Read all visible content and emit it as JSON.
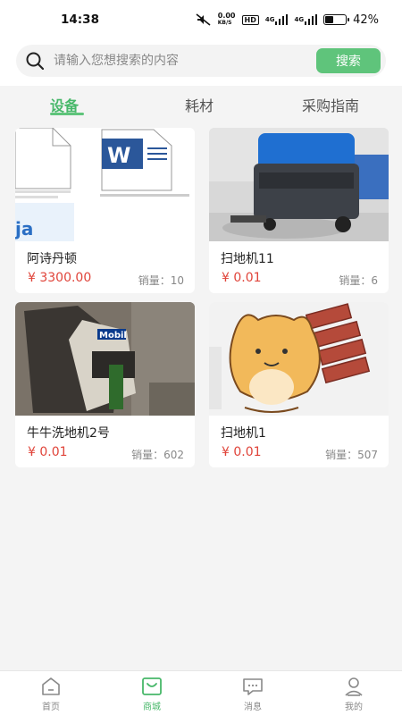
{
  "status": {
    "time": "14:38",
    "net_speed": "0.00",
    "net_unit": "KB/S",
    "hd": "HD",
    "signal1": "4G",
    "signal2": "4G",
    "battery_pct": "42%",
    "battery_level": 0.42
  },
  "search": {
    "placeholder": "请输入您想搜索的内容",
    "button_label": "搜索"
  },
  "tabs": [
    {
      "label": "设备",
      "active": true
    },
    {
      "label": "耗材",
      "active": false
    },
    {
      "label": "采购指南",
      "active": false
    }
  ],
  "products": [
    {
      "title": "阿诗丹顿",
      "price": "¥ 3300.00",
      "sales": "销量：10"
    },
    {
      "title": "扫地机11",
      "price": "¥ 0.01",
      "sales": "销量：6"
    },
    {
      "title": "牛牛洗地机2号",
      "price": "¥ 0.01",
      "sales": "销量：602"
    },
    {
      "title": "扫地机1",
      "price": "¥ 0.01",
      "sales": "销量：507"
    }
  ],
  "nav": [
    {
      "label": "首页",
      "icon": "home-icon",
      "active": false
    },
    {
      "label": "商城",
      "icon": "mall-icon",
      "active": true
    },
    {
      "label": "消息",
      "icon": "message-icon",
      "active": false
    },
    {
      "label": "我的",
      "icon": "profile-icon",
      "active": false
    }
  ],
  "colors": {
    "accent": "#5fc47b",
    "price": "#e0443a"
  }
}
